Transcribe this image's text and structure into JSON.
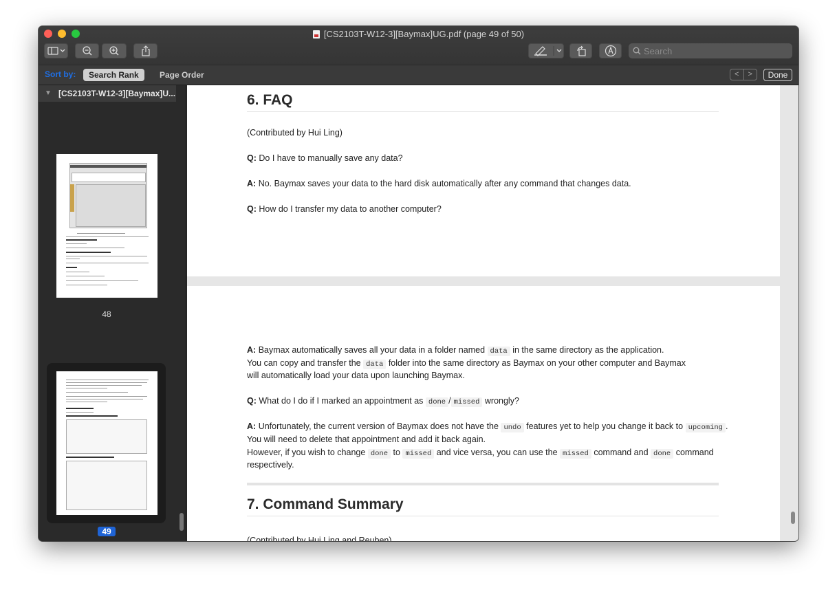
{
  "window": {
    "title": "[CS2103T-W12-3][Baymax]UG.pdf (page 49 of 50)"
  },
  "toolbar": {
    "search_placeholder": "Search"
  },
  "sortbar": {
    "label": "Sort by:",
    "options": [
      "Search Rank",
      "Page Order"
    ],
    "done_label": "Done",
    "prev_glyph": "<",
    "next_glyph": ">"
  },
  "sidebar": {
    "document_title": "[CS2103T-W12-3][Baymax]U...",
    "thumbnails": [
      {
        "page": "48",
        "selected": false
      },
      {
        "page": "49",
        "selected": true
      }
    ]
  },
  "document": {
    "faq_heading": "6. FAQ",
    "faq_contrib": "(Contributed by Hui Ling)",
    "q1_label": "Q:",
    "q1_text": "Do I have to manually save any data?",
    "a1_label": "A:",
    "a1_text": "No. Baymax saves your data to the hard disk automatically after any command that changes data.",
    "q2_label": "Q:",
    "q2_text": "How do I transfer my data to another computer?",
    "a2_label": "A:",
    "a2_part1": "Baymax automatically saves all your data in a folder named",
    "a2_code1": "data",
    "a2_part2": "in the same directory as the application.",
    "a2_line2_part1": "You can copy and transfer the",
    "a2_code2": "data",
    "a2_line2_part2": "folder into the same directory as Baymax on your other computer and Baymax",
    "a2_line3": "will automatically load your data upon launching Baymax.",
    "q3_label": "Q:",
    "q3_part1": "What do I do if I marked an appointment as",
    "q3_code1": "done",
    "q3_slash": "/",
    "q3_code2": "missed",
    "q3_part2": "wrongly?",
    "a3_label": "A:",
    "a3_part1": "Unfortunately, the current version of Baymax does not have the",
    "a3_code1": "undo",
    "a3_part2": "features yet to help you change it back to",
    "a3_code2": "upcoming",
    "a3_part3": ".",
    "a3_line2": "You will need to delete that appointment and add it back again.",
    "a3_line3_part1": "However, if you wish to change",
    "a3_code3": "done",
    "a3_to": "to",
    "a3_code4": "missed",
    "a3_line3_part2": "and vice versa, you can use the",
    "a3_code5": "missed",
    "a3_line3_part3": "command and",
    "a3_code6": "done",
    "a3_line3_part4": "command",
    "a3_line4": "respectively.",
    "summary_heading": "7. Command Summary",
    "summary_contrib": "(Contributed by Hui Ling and Reuben)"
  }
}
